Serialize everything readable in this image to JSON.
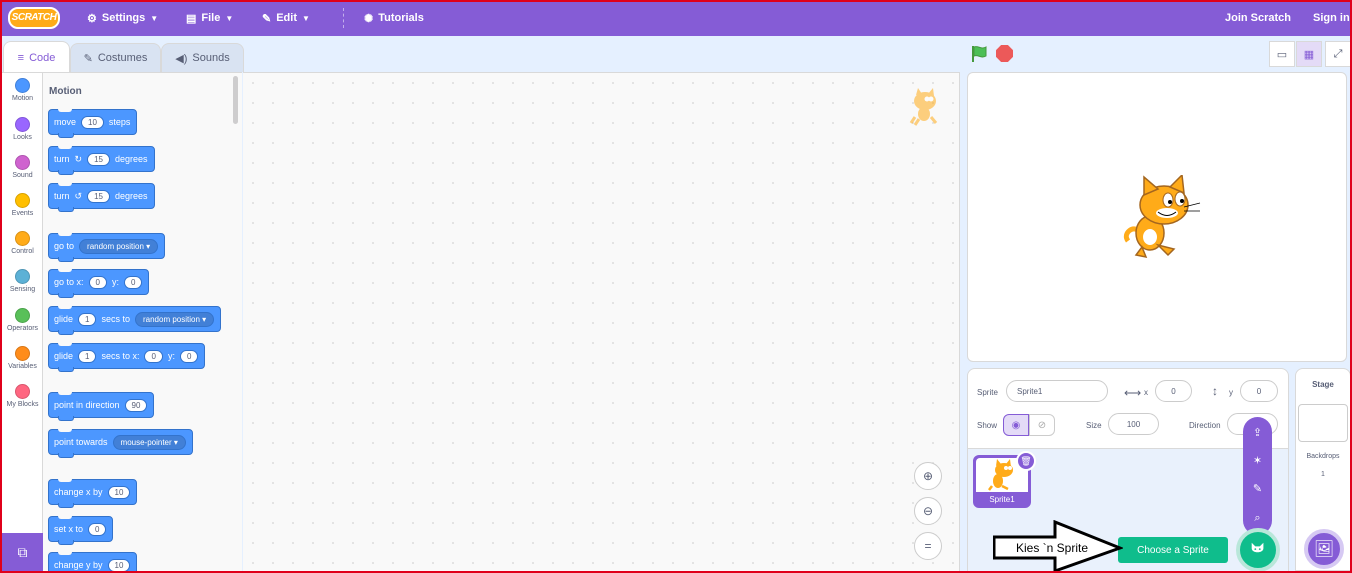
{
  "menubar": {
    "logo": "SCRATCH",
    "settings": "Settings",
    "file": "File",
    "edit": "Edit",
    "tutorials": "Tutorials",
    "join": "Join Scratch",
    "signin": "Sign in",
    "color": "#855cd6"
  },
  "tabs": {
    "code": "Code",
    "costumes": "Costumes",
    "sounds": "Sounds"
  },
  "categories": [
    {
      "label": "Motion",
      "color": "#4c97ff"
    },
    {
      "label": "Looks",
      "color": "#9966ff"
    },
    {
      "label": "Sound",
      "color": "#cf63cf"
    },
    {
      "label": "Events",
      "color": "#ffbf00"
    },
    {
      "label": "Control",
      "color": "#ffab19"
    },
    {
      "label": "Sensing",
      "color": "#5cb1d6"
    },
    {
      "label": "Operators",
      "color": "#59c059"
    },
    {
      "label": "Variables",
      "color": "#ff8c1a"
    },
    {
      "label": "My Blocks",
      "color": "#ff6680"
    }
  ],
  "palette": {
    "title": "Motion",
    "move": {
      "a": "move",
      "v": "10",
      "b": "steps"
    },
    "turn_right": {
      "a": "turn",
      "v": "15",
      "b": "degrees"
    },
    "turn_left": {
      "a": "turn",
      "v": "15",
      "b": "degrees"
    },
    "goto": {
      "a": "go to",
      "opt": "random position"
    },
    "goto_xy": {
      "a": "go to x:",
      "x": "0",
      "b": "y:",
      "y": "0"
    },
    "glide_to": {
      "a": "glide",
      "v": "1",
      "b": "secs to",
      "opt": "random position"
    },
    "glide_xy": {
      "a": "glide",
      "v": "1",
      "b": "secs to x:",
      "x": "0",
      "c": "y:",
      "y": "0"
    },
    "point_dir": {
      "a": "point in direction",
      "v": "90"
    },
    "point_towards": {
      "a": "point towards",
      "opt": "mouse-pointer"
    },
    "change_x": {
      "a": "change x by",
      "v": "10"
    },
    "set_x": {
      "a": "set x to",
      "v": "0"
    },
    "change_y": {
      "a": "change y by",
      "v": "10"
    }
  },
  "sprite_info": {
    "sprite_label": "Sprite",
    "sprite_name": "Sprite1",
    "x_label": "x",
    "x": "0",
    "y_label": "y",
    "y": "0",
    "show_label": "Show",
    "size_label": "Size",
    "size": "100",
    "direction_label": "Direction"
  },
  "sprites": [
    {
      "name": "Sprite1"
    }
  ],
  "choose_sprite": "Choose a Sprite",
  "stage_pane": {
    "title": "Stage",
    "backdrops_label": "Backdrops",
    "backdrops_count": "1"
  },
  "annotation": "Kies `n Sprite"
}
